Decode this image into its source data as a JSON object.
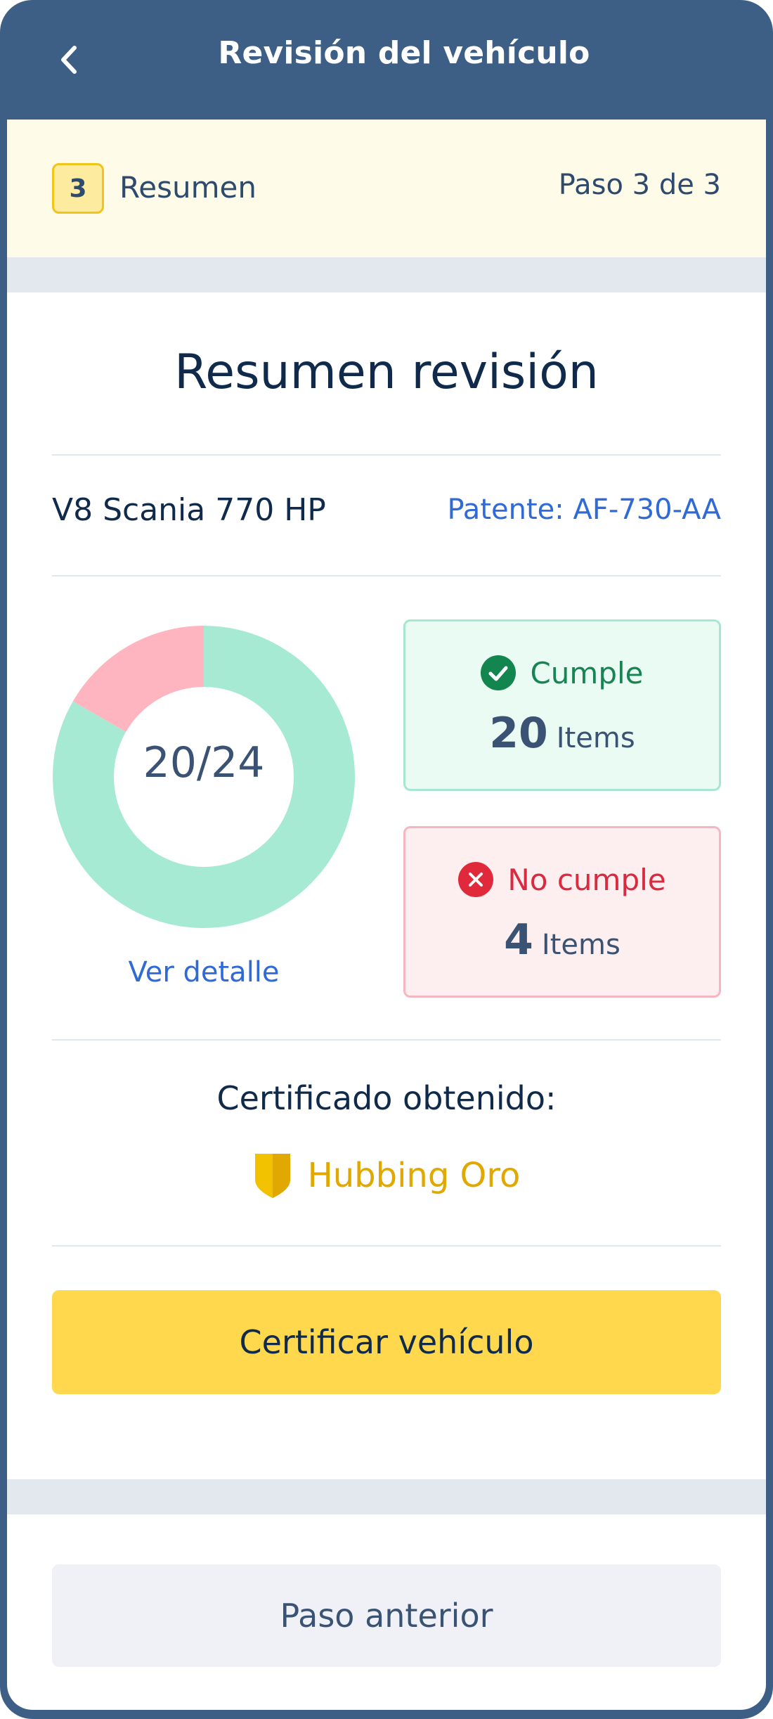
{
  "header": {
    "title": "Revisión del vehículo"
  },
  "step": {
    "number": "3",
    "label": "Resumen",
    "counter": "Paso 3 de 3"
  },
  "summary": {
    "title": "Resumen revisión",
    "vehicle_name": "V8 Scania 770 HP",
    "plate": "Patente: AF-730-AA",
    "score_label": "20/24",
    "detail_link": "Ver detalle",
    "passed_count": 20,
    "total_count": 24,
    "colors": {
      "pass": "#a6ead4",
      "fail": "#ffb5c0"
    }
  },
  "cards": {
    "ok": {
      "label": "Cumple",
      "count": "20",
      "unit": "Items",
      "icon": "check-circle-icon"
    },
    "bad": {
      "label": "No cumple",
      "count": "4",
      "unit": "Items",
      "icon": "x-circle-icon"
    }
  },
  "certificate": {
    "title": "Certificado obtenido:",
    "name": "Hubbing Oro",
    "icon": "shield-icon",
    "color": "#f0bf00"
  },
  "actions": {
    "certify": "Certificar vehículo",
    "previous": "Paso anterior"
  }
}
